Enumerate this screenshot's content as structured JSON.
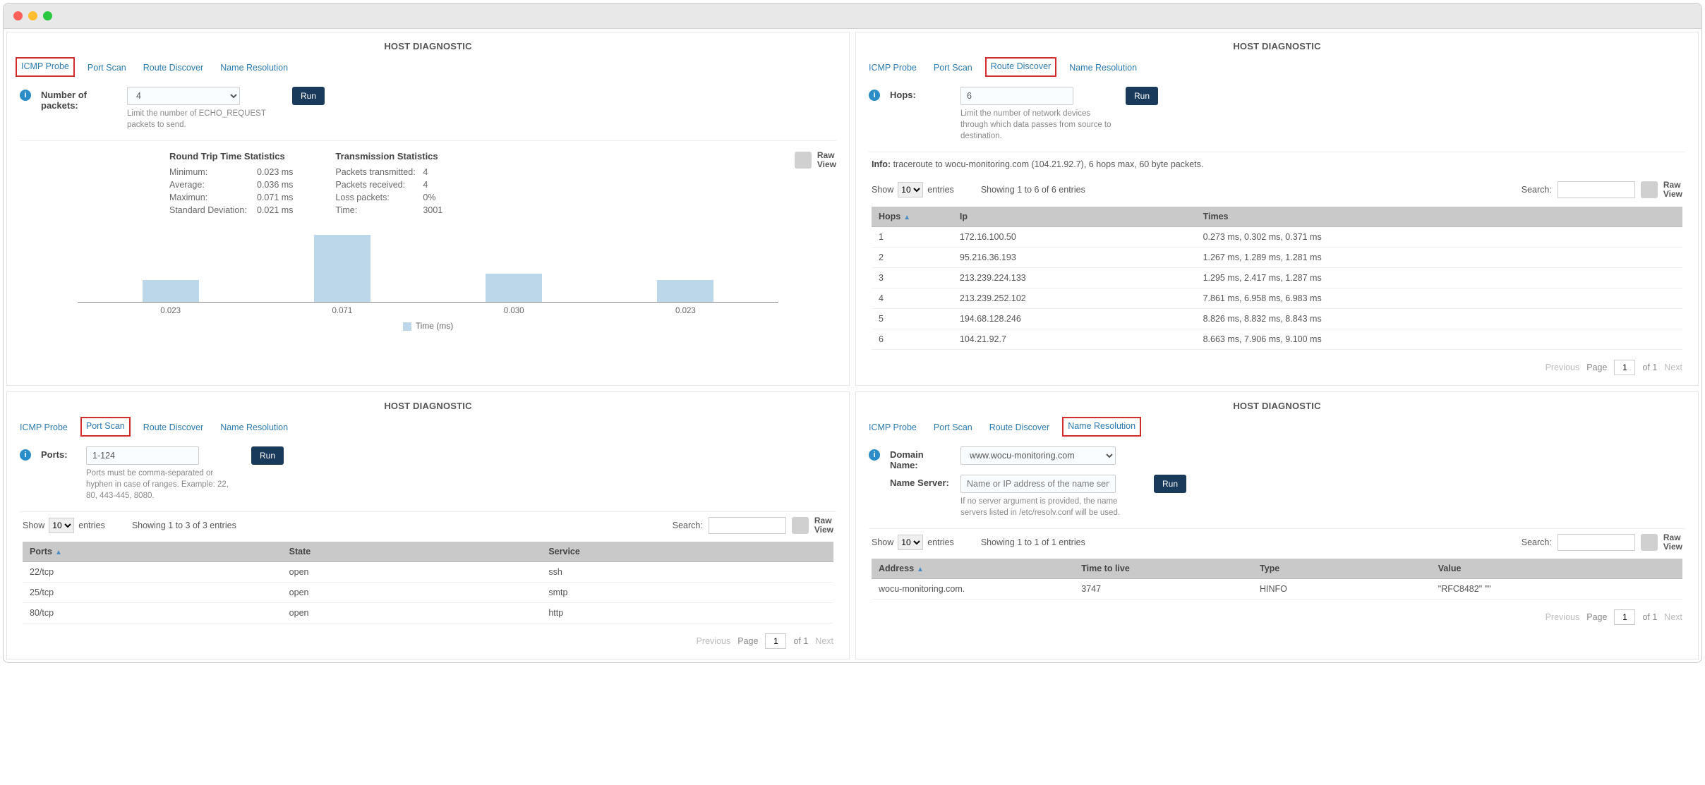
{
  "window": {
    "title": "HOST DIAGNOSTIC"
  },
  "tabs": {
    "icmp": "ICMP Probe",
    "portscan": "Port Scan",
    "route": "Route Discover",
    "nameres": "Name Resolution"
  },
  "common": {
    "run": "Run",
    "raw_view": "Raw View",
    "show": "Show",
    "entries": "entries",
    "search": "Search:",
    "previous": "Previous",
    "page": "Page",
    "of1": "of 1",
    "next": "Next",
    "page_val": "1",
    "entries_val": "10"
  },
  "icmp": {
    "label": "Number of packets:",
    "value": "4",
    "help": "Limit the number of ECHO_REQUEST packets to send.",
    "rtt_title": "Round Trip Time Statistics",
    "tx_title": "Transmission Statistics",
    "stats": {
      "min_k": "Minimum:",
      "min_v": "0.023 ms",
      "avg_k": "Average:",
      "avg_v": "0.036 ms",
      "max_k": "Maximun:",
      "max_v": "0.071 ms",
      "std_k": "Standard Deviation:",
      "std_v": "0.021 ms",
      "ptx_k": "Packets transmitted:",
      "ptx_v": "4",
      "prx_k": "Packets received:",
      "prx_v": "4",
      "loss_k": "Loss packets:",
      "loss_v": "0%",
      "time_k": "Time:",
      "time_v": "3001"
    },
    "chart_legend": "Time (ms)"
  },
  "chart_data": {
    "type": "bar",
    "categories": [
      "0.023",
      "0.071",
      "0.030",
      "0.023"
    ],
    "values": [
      0.023,
      0.071,
      0.03,
      0.023
    ],
    "title": "Time (ms)",
    "xlabel": "",
    "ylabel": "",
    "ylim": [
      0,
      0.08
    ]
  },
  "route": {
    "label": "Hops:",
    "value": "6",
    "help": "Limit the number of network devices through which data passes from source to destination.",
    "info_label": "Info:",
    "info_text": "traceroute to wocu-monitoring.com (104.21.92.7), 6 hops max, 60 byte packets.",
    "showing": "Showing 1 to 6 of 6 entries",
    "headers": {
      "hops": "Hops",
      "ip": "Ip",
      "times": "Times"
    },
    "rows": [
      {
        "h": "1",
        "ip": "172.16.100.50",
        "t": "0.273 ms, 0.302 ms, 0.371 ms"
      },
      {
        "h": "2",
        "ip": "95.216.36.193",
        "t": "1.267 ms, 1.289 ms, 1.281 ms"
      },
      {
        "h": "3",
        "ip": "213.239.224.133",
        "t": "1.295 ms, 2.417 ms, 1.287 ms"
      },
      {
        "h": "4",
        "ip": "213.239.252.102",
        "t": "7.861 ms, 6.958 ms, 6.983 ms"
      },
      {
        "h": "5",
        "ip": "194.68.128.246",
        "t": "8.826 ms, 8.832 ms, 8.843 ms"
      },
      {
        "h": "6",
        "ip": "104.21.92.7",
        "t": "8.663 ms, 7.906 ms, 9.100 ms"
      }
    ]
  },
  "portscan": {
    "label": "Ports:",
    "value": "1-124",
    "help": "Ports must be comma-separated or hyphen in case of ranges. Example: 22, 80, 443-445, 8080.",
    "showing": "Showing 1 to 3 of 3 entries",
    "headers": {
      "ports": "Ports",
      "state": "State",
      "service": "Service"
    },
    "rows": [
      {
        "p": "22/tcp",
        "s": "open",
        "sv": "ssh"
      },
      {
        "p": "25/tcp",
        "s": "open",
        "sv": "smtp"
      },
      {
        "p": "80/tcp",
        "s": "open",
        "sv": "http"
      }
    ]
  },
  "nameres": {
    "domain_label": "Domain Name:",
    "domain_value": "www.wocu-monitoring.com",
    "ns_label": "Name Server:",
    "ns_placeholder": "Name or IP address of the name server to query",
    "ns_help": "If no server argument is provided, the name servers listed in /etc/resolv.conf will be used.",
    "showing": "Showing 1 to 1 of 1 entries",
    "headers": {
      "addr": "Address",
      "ttl": "Time to live",
      "type": "Type",
      "value": "Value"
    },
    "rows": [
      {
        "a": "wocu-monitoring.com.",
        "ttl": "3747",
        "ty": "HINFO",
        "v": "\"RFC8482\" \"\""
      }
    ]
  }
}
